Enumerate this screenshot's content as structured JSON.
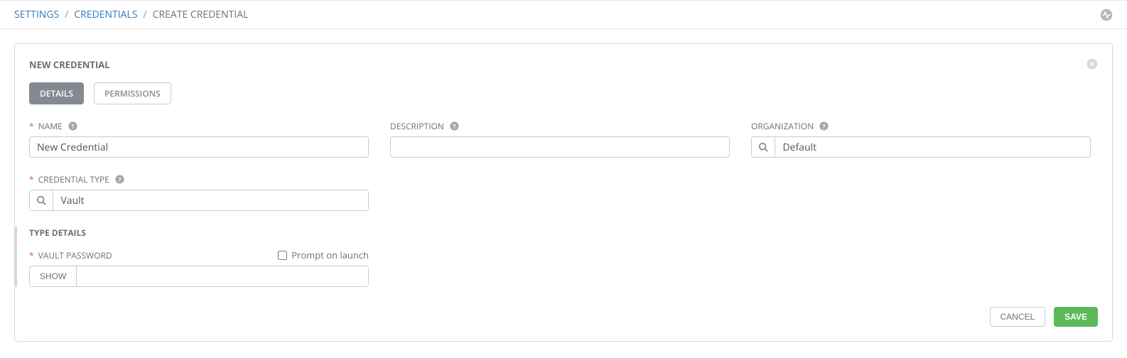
{
  "breadcrumb": {
    "settings": "SETTINGS",
    "credentials": "CREDENTIALS",
    "current": "CREATE CREDENTIAL"
  },
  "panel": {
    "title": "NEW CREDENTIAL"
  },
  "tabs": {
    "details": "DETAILS",
    "permissions": "PERMISSIONS"
  },
  "labels": {
    "name": "NAME",
    "description": "DESCRIPTION",
    "organization": "ORGANIZATION",
    "credential_type": "CREDENTIAL TYPE",
    "type_details": "TYPE DETAILS",
    "vault_password": "VAULT PASSWORD",
    "prompt_on_launch": "Prompt on launch",
    "show": "SHOW"
  },
  "fields": {
    "name": "New Credential",
    "description": "",
    "organization": "Default",
    "credential_type": "Vault",
    "vault_password": ""
  },
  "buttons": {
    "cancel": "CANCEL",
    "save": "SAVE"
  },
  "icons": {
    "search": "search-icon",
    "help": "help-icon",
    "close": "close-icon",
    "activity": "activity-icon"
  }
}
